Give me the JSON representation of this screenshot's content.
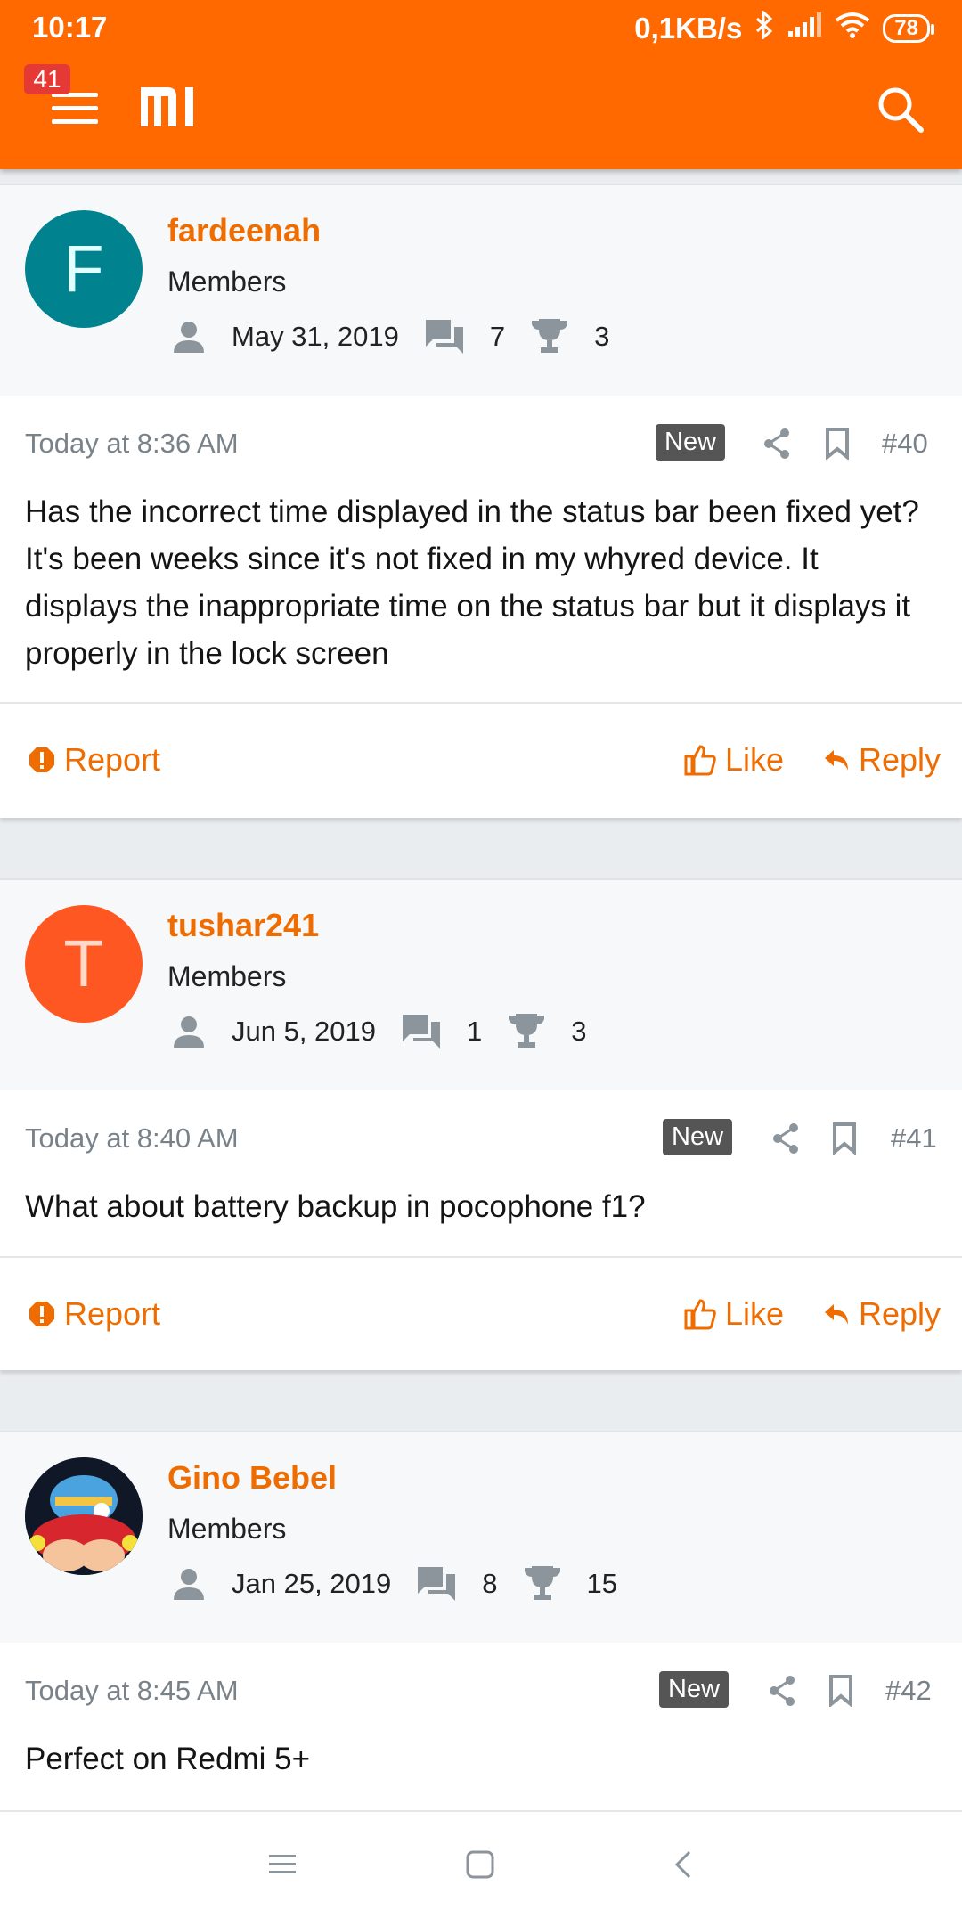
{
  "status_bar": {
    "time": "10:17",
    "network_speed": "0,1KB/s",
    "battery": "78",
    "icons": [
      "bluetooth-icon",
      "signal-icon",
      "wifi-icon",
      "battery-icon"
    ]
  },
  "header": {
    "notification_count": "41",
    "logo": "mi",
    "icons": [
      "menu-icon",
      "search-icon"
    ],
    "color": "#ff6900"
  },
  "posts": [
    {
      "author": {
        "name": "fardeenah",
        "initial": "F",
        "avatar_color": "#00838f",
        "role": "Members",
        "joined": "May 31, 2019",
        "messages": "7",
        "trophies": "3"
      },
      "time": "Today at 8:36 AM",
      "badge": "New",
      "number": "#40",
      "text": "Has the incorrect time displayed in the status bar been fixed yet? It's been weeks since it's not fixed in my whyred device. It displays the inappropriate time on the status bar but it displays it properly in the lock screen",
      "actions": {
        "report": "Report",
        "like": "Like",
        "reply": "Reply"
      }
    },
    {
      "author": {
        "name": "tushar241",
        "initial": "T",
        "avatar_color": "#ff5722",
        "role": "Members",
        "joined": "Jun 5, 2019",
        "messages": "1",
        "trophies": "3"
      },
      "time": "Today at 8:40 AM",
      "badge": "New",
      "number": "#41",
      "text": "What about battery backup in pocophone f1?",
      "actions": {
        "report": "Report",
        "like": "Like",
        "reply": "Reply"
      }
    },
    {
      "author": {
        "name": "Gino Bebel",
        "initial": "",
        "avatar_color": "#1a1a2e",
        "role": "Members",
        "joined": "Jan 25, 2019",
        "messages": "8",
        "trophies": "15"
      },
      "time": "Today at 8:45 AM",
      "badge": "New",
      "number": "#42",
      "text": "Perfect on Redmi 5+"
    }
  ],
  "nav_bar": {
    "icons": [
      "recents-icon",
      "home-icon",
      "back-icon"
    ]
  }
}
